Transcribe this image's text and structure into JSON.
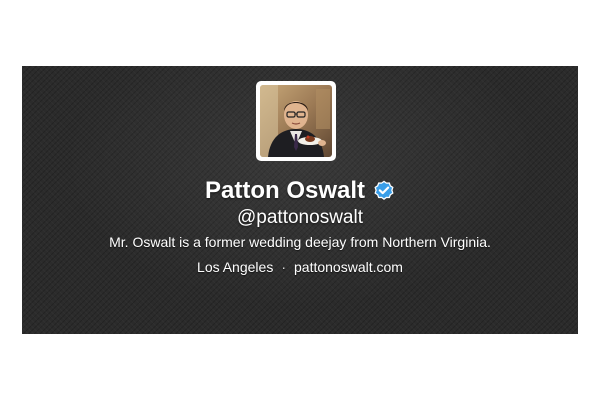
{
  "profile": {
    "name": "Patton Oswalt",
    "handle": "@pattonoswalt",
    "bio": "Mr. Oswalt is a former wedding deejay from Northern Virginia.",
    "location": "Los Angeles",
    "separator": "·",
    "website": "pattonoswalt.com",
    "verified": true,
    "verified_badge_color": "#3a9ee8"
  },
  "card": {
    "background_color": "#2b2b2b",
    "text_color": "#ffffff"
  },
  "avatar": {
    "icon": "profile-photo"
  }
}
